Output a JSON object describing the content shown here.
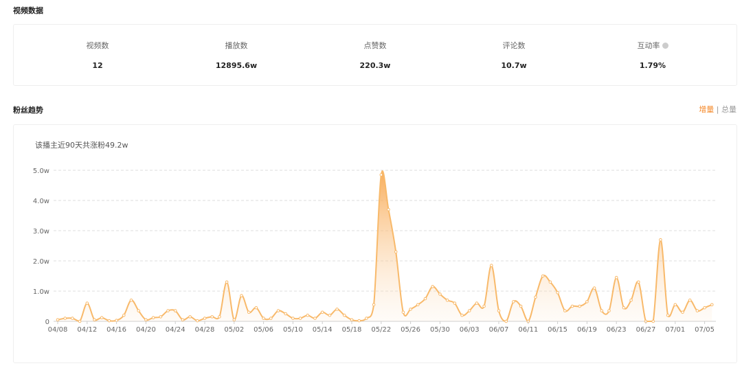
{
  "video_section": {
    "title": "视频数据",
    "stats": [
      {
        "label": "视频数",
        "value": "12"
      },
      {
        "label": "播放数",
        "value": "12895.6w"
      },
      {
        "label": "点赞数",
        "value": "220.3w"
      },
      {
        "label": "评论数",
        "value": "10.7w"
      },
      {
        "label": "互动率",
        "value": "1.79%"
      }
    ]
  },
  "fans_section": {
    "title": "粉丝趋势",
    "toggle": {
      "increment": "增量",
      "separator": "|",
      "total": "总量"
    },
    "summary": "该播主近90天共涨粉49.2w"
  },
  "colors": {
    "accent": "#f5892a",
    "line": "#f8b96a"
  },
  "chart_data": {
    "type": "area",
    "title": "",
    "xlabel": "",
    "ylabel": "",
    "y_ticks": [
      "0",
      "1.0w",
      "2.0w",
      "3.0w",
      "4.0w",
      "5.0w"
    ],
    "ylim": [
      0,
      5
    ],
    "unit": "w",
    "grid": true,
    "x_tick_labels": [
      "04/08",
      "04/12",
      "04/16",
      "04/20",
      "04/24",
      "04/28",
      "05/02",
      "05/06",
      "05/10",
      "05/14",
      "05/18",
      "05/22",
      "05/26",
      "05/30",
      "06/03",
      "06/07",
      "06/11",
      "06/15",
      "06/19",
      "06/23",
      "06/27",
      "07/01",
      "07/05"
    ],
    "start_date": "04/08",
    "values": [
      0.05,
      0.1,
      0.1,
      0.0,
      0.6,
      0.05,
      0.12,
      0.02,
      0.03,
      0.2,
      0.7,
      0.35,
      0.05,
      0.12,
      0.15,
      0.35,
      0.35,
      0.05,
      0.15,
      0.02,
      0.1,
      0.15,
      0.15,
      1.3,
      0.05,
      0.85,
      0.3,
      0.45,
      0.1,
      0.1,
      0.35,
      0.25,
      0.1,
      0.1,
      0.2,
      0.1,
      0.3,
      0.2,
      0.4,
      0.2,
      0.05,
      0.02,
      0.1,
      0.55,
      4.85,
      3.7,
      2.3,
      0.3,
      0.4,
      0.55,
      0.75,
      1.15,
      0.9,
      0.7,
      0.6,
      0.2,
      0.35,
      0.6,
      0.5,
      1.85,
      0.35,
      0.0,
      0.65,
      0.5,
      0.0,
      0.8,
      1.5,
      1.3,
      0.95,
      0.35,
      0.5,
      0.5,
      0.65,
      1.1,
      0.35,
      0.35,
      1.45,
      0.45,
      0.7,
      1.3,
      0.0,
      0.0,
      2.7,
      0.2,
      0.55,
      0.3,
      0.7,
      0.35,
      0.45,
      0.55
    ]
  }
}
